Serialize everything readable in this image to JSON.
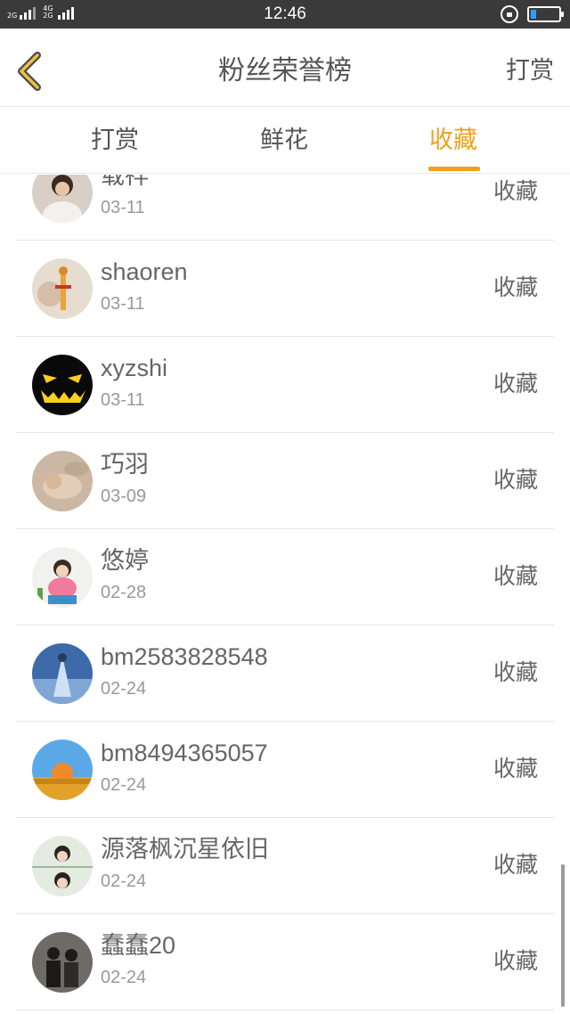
{
  "status_bar": {
    "sim1_label": "2G",
    "sim2_label_top": "4G",
    "sim2_label_bottom": "2G",
    "time": "12:46",
    "battery_level": 0.2,
    "battery_color": "#2e9df7"
  },
  "header": {
    "back_icon": "chevron-left-icon",
    "title": "粉丝荣誉榜",
    "action_label": "打赏"
  },
  "tabs": [
    {
      "label": "打赏",
      "active": false
    },
    {
      "label": "鲜花",
      "active": false
    },
    {
      "label": "收藏",
      "active": true
    }
  ],
  "accent_color": "#f0a020",
  "list": [
    {
      "name": "载祥",
      "date": "03-11",
      "type": "收藏"
    },
    {
      "name": "shaoren",
      "date": "03-11",
      "type": "收藏"
    },
    {
      "name": "xyzshi",
      "date": "03-11",
      "type": "收藏"
    },
    {
      "name": "巧羽",
      "date": "03-09",
      "type": "收藏"
    },
    {
      "name": "悠婷",
      "date": "02-28",
      "type": "收藏"
    },
    {
      "name": "bm2583828548",
      "date": "02-24",
      "type": "收藏"
    },
    {
      "name": "bm8494365057",
      "date": "02-24",
      "type": "收藏"
    },
    {
      "name": "源落枫沉星依旧",
      "date": "02-24",
      "type": "收藏"
    },
    {
      "name": "蠢蠢20",
      "date": "02-24",
      "type": "收藏"
    }
  ]
}
